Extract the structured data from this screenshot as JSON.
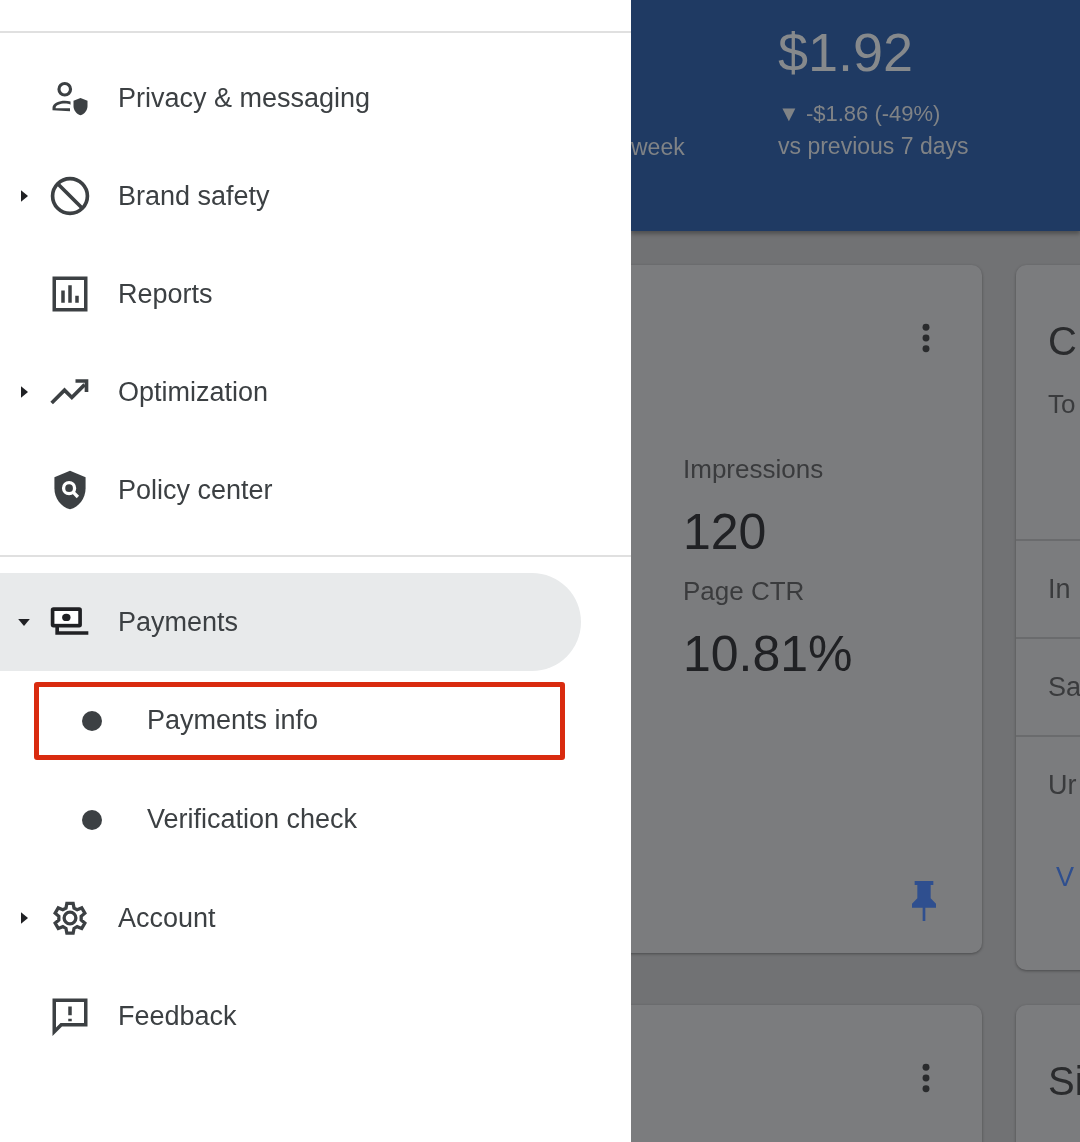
{
  "nav": {
    "groups": [
      {
        "items": [
          {
            "label": "Privacy & messaging",
            "selected": false
          },
          {
            "label": "Brand safety",
            "expanded": false,
            "selected": false
          },
          {
            "label": "Reports",
            "selected": false
          },
          {
            "label": "Optimization",
            "expanded": false,
            "selected": false
          },
          {
            "label": "Policy center",
            "selected": false
          }
        ]
      },
      {
        "items": [
          {
            "label": "Payments",
            "expanded": true,
            "selected": true,
            "children": [
              {
                "label": "Payments info",
                "highlighted": true
              },
              {
                "label": "Verification check",
                "highlighted": false
              }
            ]
          },
          {
            "label": "Account",
            "expanded": false,
            "selected": false
          },
          {
            "label": "Feedback",
            "selected": false
          }
        ]
      }
    ]
  },
  "dashboard": {
    "header": {
      "side_label": "week",
      "value": "$1.92",
      "change": "▼ -$1.86 (-49%)",
      "comparison": "vs previous 7 days"
    },
    "cards": [
      {
        "kind": "metrics",
        "metrics": [
          {
            "label": "Impressions",
            "value": "120"
          },
          {
            "label": "Page CTR",
            "value": "10.81%"
          }
        ]
      },
      {
        "kind": "list",
        "title": "C",
        "subtitle": "To",
        "rows": [
          "In",
          "Sa",
          "Ur"
        ],
        "link": "V"
      },
      {
        "kind": "metrics"
      },
      {
        "kind": "list",
        "title": "Si"
      }
    ]
  }
}
